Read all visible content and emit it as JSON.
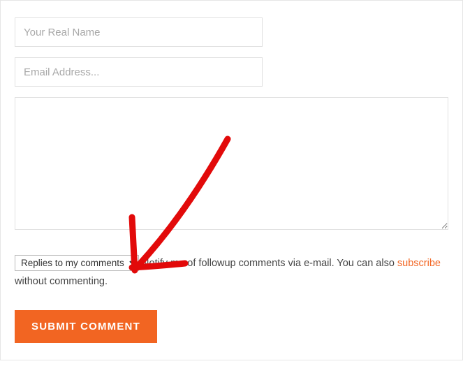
{
  "form": {
    "name_placeholder": "Your Real Name",
    "email_placeholder": "Email Address...",
    "notify_select_value": "Replies to my comments",
    "notify_text_before": " Notify me of followup comments via e-mail. You can also ",
    "subscribe_link_text": "subscribe",
    "notify_text_after": " without commenting.",
    "submit_label": "SUBMIT COMMENT"
  },
  "annotation": {
    "arrow_color": "#e20a0a"
  }
}
